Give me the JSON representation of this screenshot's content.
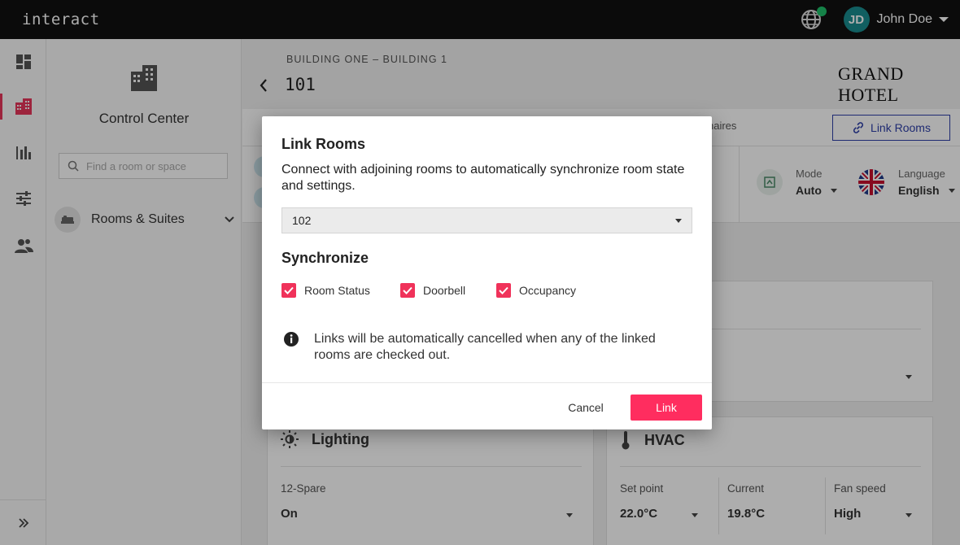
{
  "app": {
    "brand": "interact"
  },
  "user": {
    "initials": "JD",
    "name": "John Doe"
  },
  "colors": {
    "accent": "#ff2d5f",
    "online": "#20c06a",
    "link_border": "#2d3fa8",
    "topbar": "#111111"
  },
  "rail": {
    "icons": [
      "dashboard-icon",
      "building-icon",
      "bar-chart-icon",
      "sliders-icon",
      "people-icon",
      "expand-double-chevron-icon"
    ],
    "active": "building-icon"
  },
  "sidebar": {
    "title": "Control Center",
    "search_placeholder": "Find a room or space",
    "group_label": "Rooms & Suites"
  },
  "header": {
    "breadcrumb": "BUILDING ONE – BUILDING 1",
    "room": "101",
    "logo_left": "GRAND",
    "logo_right": "HOTEL"
  },
  "tabs": {
    "partial_tab": "naires",
    "link_rooms": "Link Rooms"
  },
  "status": {
    "mode_label": "Mode",
    "mode_value": "Auto",
    "language_label": "Language",
    "language_value": "English"
  },
  "cards": {
    "lighting": {
      "title": "Lighting",
      "field_label": "12-Spare",
      "field_value": "On"
    },
    "hvac": {
      "title": "HVAC",
      "setpoint_label": "Set point",
      "setpoint_value": "22.0°C",
      "current_label": "Current",
      "current_value": "19.8°C",
      "fan_label": "Fan speed",
      "fan_value": "High"
    }
  },
  "modal": {
    "title": "Link Rooms",
    "description": "Connect with adjoining rooms to automatically synchronize room state and settings.",
    "selected_room": "102",
    "sync_title": "Synchronize",
    "checkboxes": [
      {
        "label": "Room Status",
        "checked": true
      },
      {
        "label": "Doorbell",
        "checked": true
      },
      {
        "label": "Occupancy",
        "checked": true
      }
    ],
    "info": "Links will be automatically cancelled when any of the linked rooms are checked out.",
    "cancel": "Cancel",
    "confirm": "Link"
  }
}
